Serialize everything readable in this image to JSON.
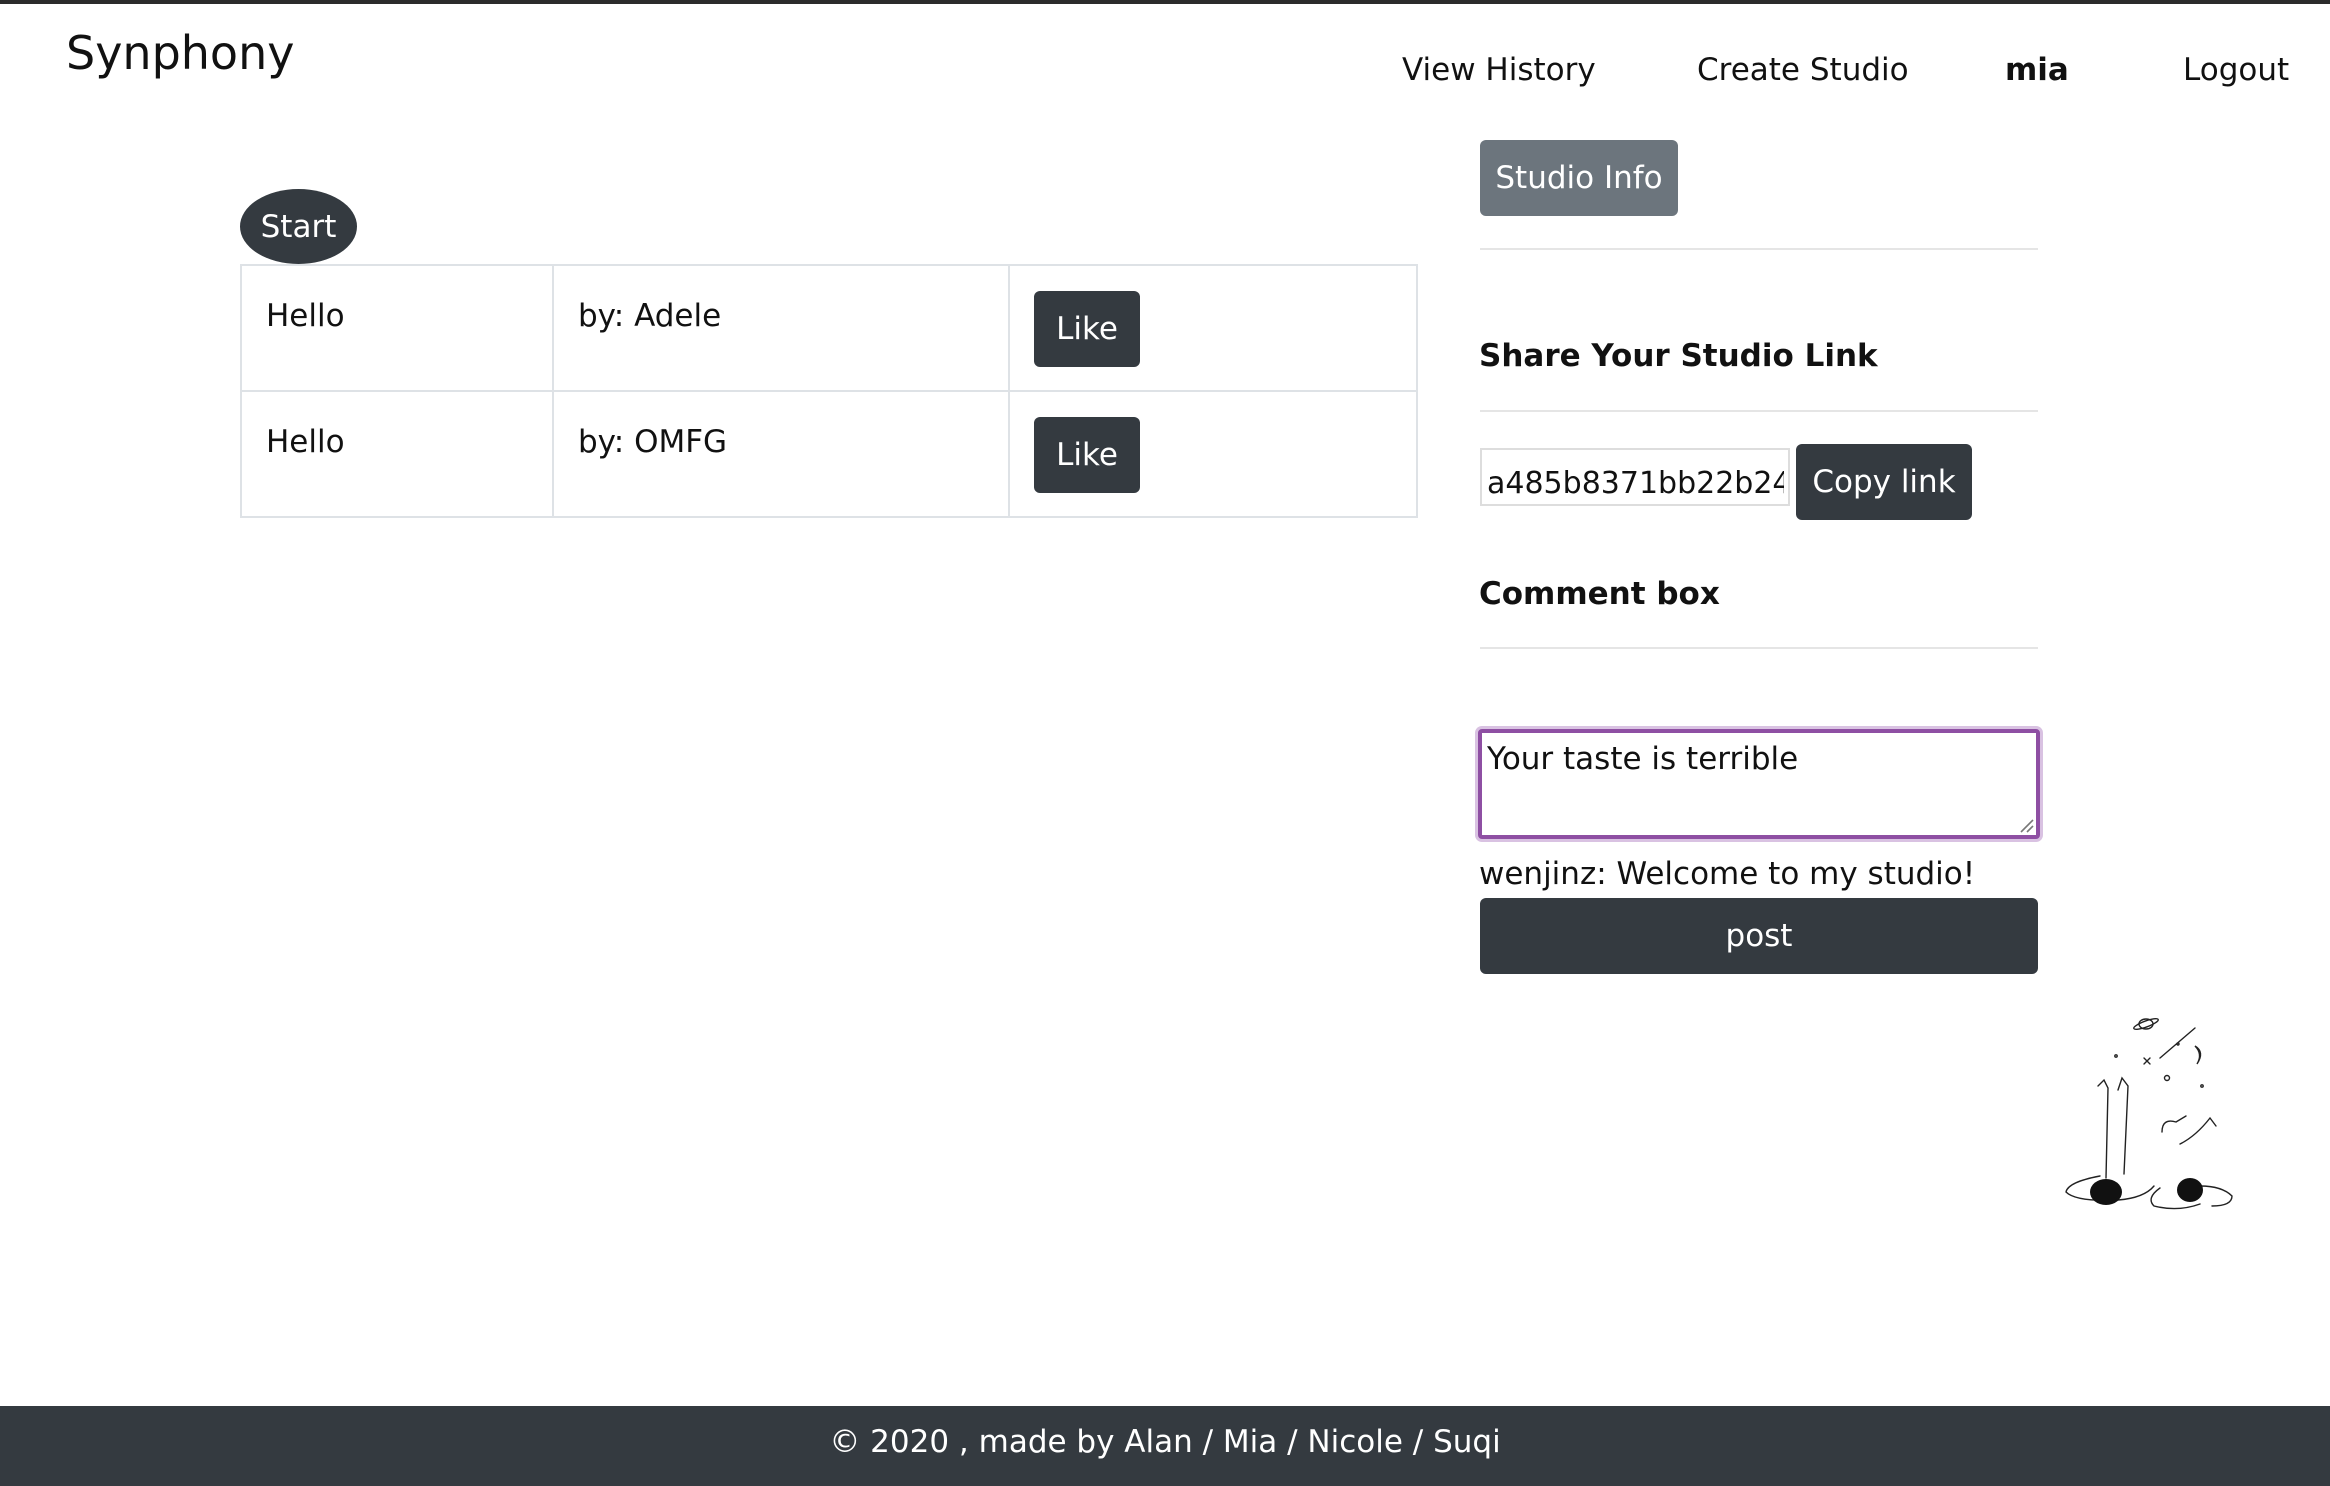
{
  "app": {
    "brand": "Synphony"
  },
  "nav": {
    "view_history": "View History",
    "create_studio": "Create Studio",
    "user": "mia",
    "logout": "Logout"
  },
  "player": {
    "start_label": "Start"
  },
  "songs": [
    {
      "title": "Hello",
      "artist": "by: Adele",
      "like_label": "Like"
    },
    {
      "title": "Hello",
      "artist": "by: OMFG",
      "like_label": "Like"
    }
  ],
  "sidebar": {
    "studio_info_label": "Studio Info",
    "share_heading": "Share Your Studio Link",
    "studio_link_value": "a485b8371bb22b24",
    "copy_link_label": "Copy link",
    "comment_heading": "Comment box",
    "comment_text": "Your taste is terrible",
    "comments": [
      {
        "text": "wenjinz: Welcome to my studio!"
      }
    ],
    "post_label": "post"
  },
  "footer": {
    "text": "© 2020 , made by Alan / Mia / Nicole / Suqi"
  },
  "colors": {
    "dark_button": "#343a40",
    "secondary_button": "#6c757d",
    "focus_border": "#8e4fa3"
  },
  "icons": {
    "illustration": "stargazing-people-illustration",
    "resize": "textarea-resize-icon"
  }
}
